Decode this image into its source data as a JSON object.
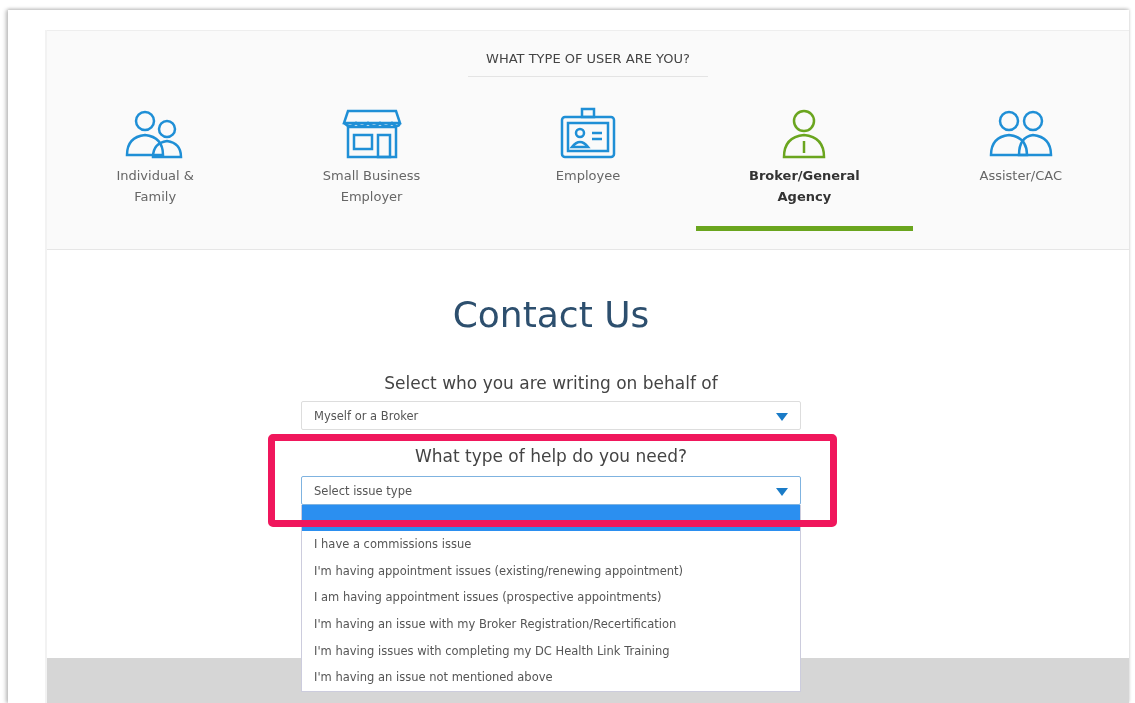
{
  "user_type": {
    "heading": "WHAT TYPE OF USER ARE YOU?",
    "tabs": [
      {
        "label": "Individual &\nFamily",
        "kind": "family",
        "selected": false
      },
      {
        "label": "Small Business\nEmployer",
        "kind": "store",
        "selected": false
      },
      {
        "label": "Employee",
        "kind": "badge",
        "selected": false
      },
      {
        "label": "Broker/General\nAgency",
        "kind": "person",
        "selected": true
      },
      {
        "label": "Assister/CAC",
        "kind": "pair",
        "selected": false
      }
    ]
  },
  "title": "Contact Us",
  "behalf": {
    "label": "Select who you are writing on behalf of",
    "value": "Myself or a Broker"
  },
  "help": {
    "label": "What type of help do you need?",
    "placeholder": "Select issue type",
    "highlighted": true,
    "options": [
      {
        "label": "I have a commissions issue",
        "selected": false
      },
      {
        "label": "I'm having appointment issues (existing/renewing appointment)",
        "selected": false
      },
      {
        "label": "I am having appointment issues (prospective appointments)",
        "selected": false
      },
      {
        "label": "I'm having an issue with my Broker Registration/Recertification",
        "selected": false
      },
      {
        "label": "I'm having issues with completing my DC Health Link Training",
        "selected": false
      },
      {
        "label": "I'm having an issue not mentioned above",
        "selected": false
      }
    ]
  }
}
